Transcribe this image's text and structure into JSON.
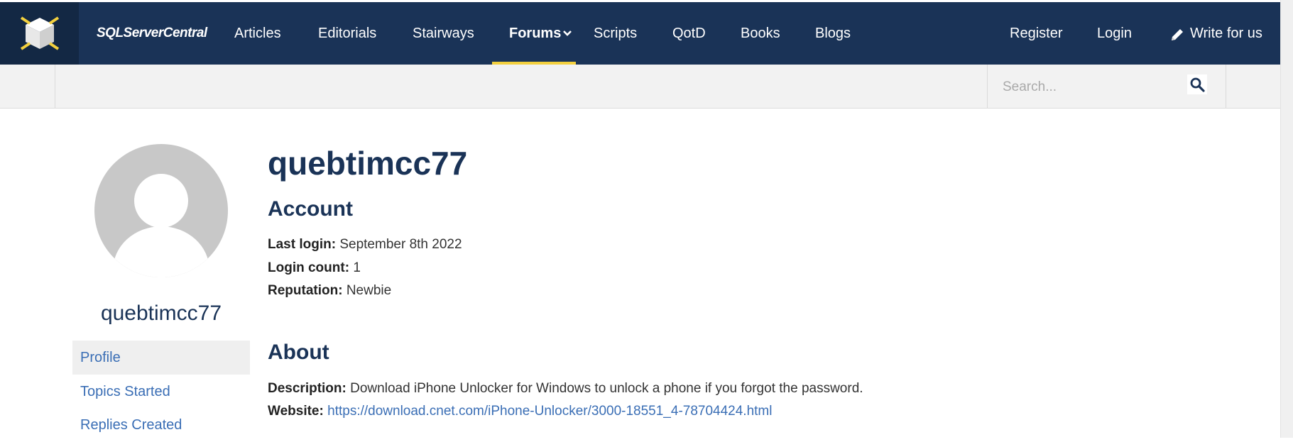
{
  "header": {
    "brand": "SQLServerCentral",
    "nav": [
      {
        "label": "Articles"
      },
      {
        "label": "Editorials"
      },
      {
        "label": "Stairways"
      },
      {
        "label": "Forums"
      },
      {
        "label": "Scripts"
      },
      {
        "label": "QotD"
      },
      {
        "label": "Books"
      },
      {
        "label": "Blogs"
      }
    ],
    "active_nav": "Forums",
    "register": "Register",
    "login": "Login",
    "write": "Write for us"
  },
  "search": {
    "placeholder": "Search..."
  },
  "sidebar": {
    "username": "quebtimcc77",
    "links": [
      {
        "label": "Profile",
        "active": true
      },
      {
        "label": "Topics Started"
      },
      {
        "label": "Replies Created"
      }
    ]
  },
  "profile": {
    "title": "quebtimcc77",
    "account_heading": "Account",
    "last_login_label": "Last login:",
    "last_login": "September 8th 2022",
    "login_count_label": "Login count:",
    "login_count": "1",
    "reputation_label": "Reputation:",
    "reputation": "Newbie",
    "about_heading": "About",
    "description_label": "Description:",
    "description": "Download iPhone Unlocker for Windows to unlock a phone if you forgot the password.",
    "website_label": "Website:",
    "website": "https://download.cnet.com/iPhone-Unlocker/3000-18551_4-78704424.html"
  },
  "colors": {
    "header_bg": "#1a3357",
    "accent": "#f3d03e",
    "link": "#3a6eb5"
  }
}
